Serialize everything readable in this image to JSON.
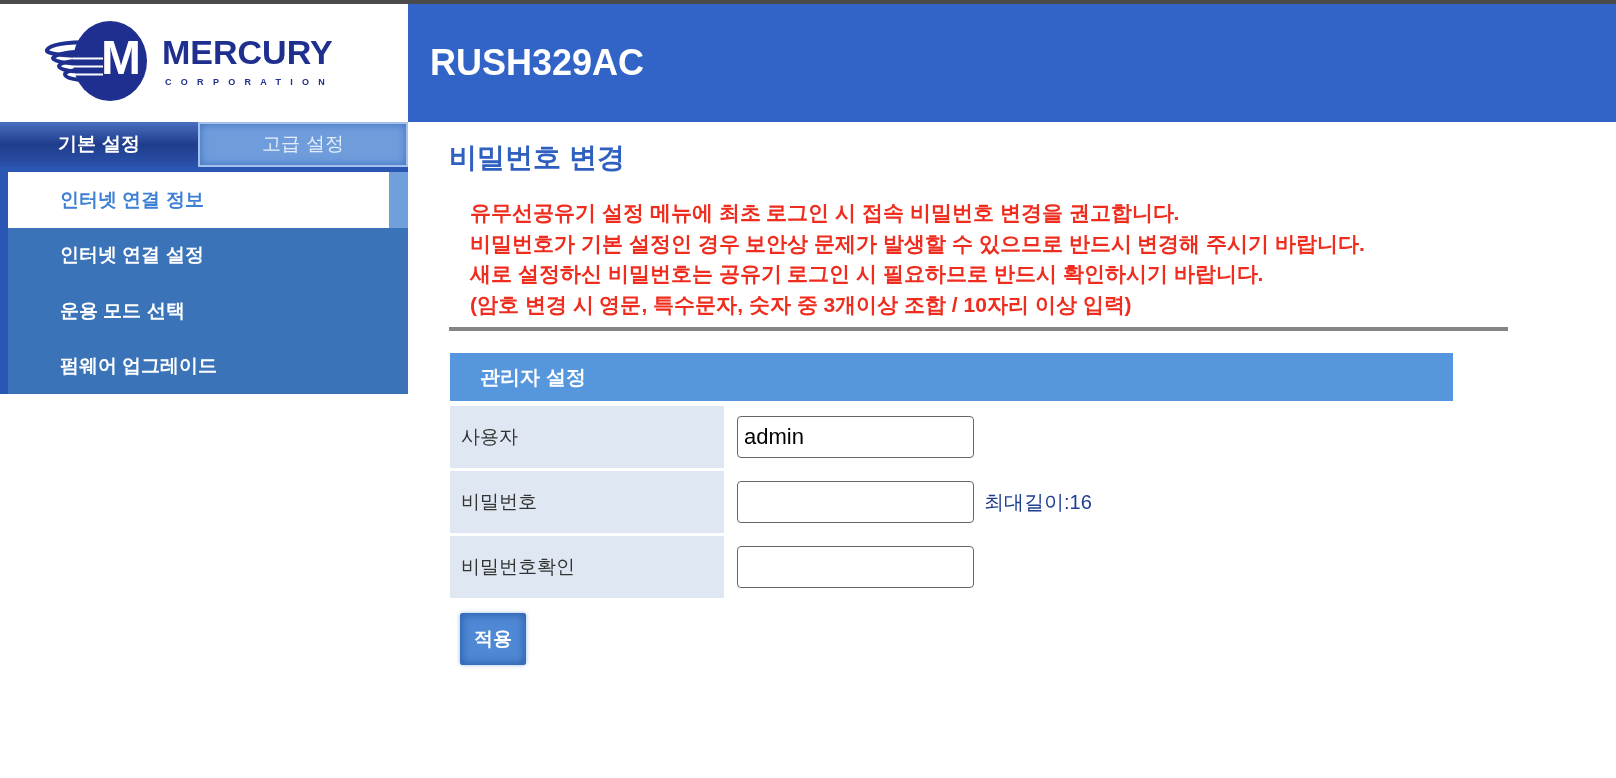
{
  "logo": {
    "mark": "M",
    "name": "MERCURY",
    "subtitle": "CORPORATION"
  },
  "header": {
    "title": "RUSH329AC"
  },
  "sidebar": {
    "tabs": [
      {
        "label": "기본 설정",
        "selected": true
      },
      {
        "label": "고급 설정",
        "selected": false
      }
    ],
    "items": [
      {
        "label": "인터넷 연결 정보",
        "selected": true
      },
      {
        "label": "인터넷 연결 설정",
        "selected": false
      },
      {
        "label": "운용 모드 선택",
        "selected": false
      },
      {
        "label": "펌웨어 업그레이드",
        "selected": false
      }
    ]
  },
  "page": {
    "title": "비밀번호 변경",
    "notices": [
      "유무선공유기 설정 메뉴에 최초 로그인 시 접속 비밀번호 변경을 권고합니다.",
      "비밀번호가 기본 설정인 경우 보안상 문제가 발생할 수 있으므로 반드시 변경해 주시기 바랍니다.",
      "새로 설정하신 비밀번호는 공유기 로그인 시 필요하므로 반드시 확인하시기 바랍니다.",
      "(암호 변경 시 영문, 특수문자, 숫자 중 3개이상 조합 / 10자리 이상 입력)"
    ]
  },
  "admin_settings": {
    "title": "관리자 설정",
    "fields": [
      {
        "label": "사용자",
        "value": "admin"
      },
      {
        "label": "비밀번호",
        "note": "최대길이:16"
      },
      {
        "label": "비밀번호확인"
      }
    ]
  },
  "apply_button": {
    "label": "적용"
  }
}
